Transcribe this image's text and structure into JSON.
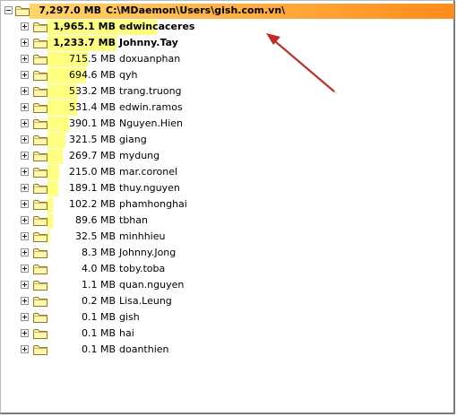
{
  "root": {
    "size": "7,297.0 MB",
    "path": "C:\\MDaemon\\Users\\gish.com.vn\\",
    "expanded": true
  },
  "items": [
    {
      "size": "1,965.1 MB",
      "name": "edwincaceres",
      "share": 0.2693,
      "bold": true
    },
    {
      "size": "1,233.7 MB",
      "name": "Johnny.Tay",
      "share": 0.1691,
      "bold": true
    },
    {
      "size": "715.5 MB",
      "name": "doxuanphan",
      "share": 0.0981
    },
    {
      "size": "694.6 MB",
      "name": "qyh",
      "share": 0.0952
    },
    {
      "size": "533.2 MB",
      "name": "trang.truong",
      "share": 0.0731
    },
    {
      "size": "531.4 MB",
      "name": "edwin.ramos",
      "share": 0.0728
    },
    {
      "size": "390.1 MB",
      "name": "Nguyen.Hien",
      "share": 0.0535
    },
    {
      "size": "321.5 MB",
      "name": "giang",
      "share": 0.0441
    },
    {
      "size": "269.7 MB",
      "name": "mydung",
      "share": 0.037
    },
    {
      "size": "215.0 MB",
      "name": "mar.coronel",
      "share": 0.0295
    },
    {
      "size": "189.1 MB",
      "name": "thuy.nguyen",
      "share": 0.0259
    },
    {
      "size": "102.2 MB",
      "name": "phamhonghai",
      "share": 0.014
    },
    {
      "size": "89.6 MB",
      "name": "tbhan",
      "share": 0.0123
    },
    {
      "size": "32.5 MB",
      "name": "minhhieu",
      "share": 0.0045
    },
    {
      "size": "8.3 MB",
      "name": "Johnny.Jong",
      "share": 0.0011
    },
    {
      "size": "4.0 MB",
      "name": "toby.toba",
      "share": 0.0005
    },
    {
      "size": "1.1 MB",
      "name": "quan.nguyen",
      "share": 0.0002
    },
    {
      "size": "0.2 MB",
      "name": "Lisa.Leung",
      "share": 0.0
    },
    {
      "size": "0.1 MB",
      "name": "gish",
      "share": 0.0
    },
    {
      "size": "0.1 MB",
      "name": "hai",
      "share": 0.0
    },
    {
      "size": "0.1 MB",
      "name": "doanthien",
      "share": 0.0
    }
  ],
  "icons": {
    "expander": "plus-box-icon",
    "folder": "folder-icon",
    "annotation": "arrow-icon"
  },
  "colors": {
    "bar": "#ffff80",
    "root_bar": "#ff8c1a",
    "annotation_arrow": "#c0282a"
  }
}
